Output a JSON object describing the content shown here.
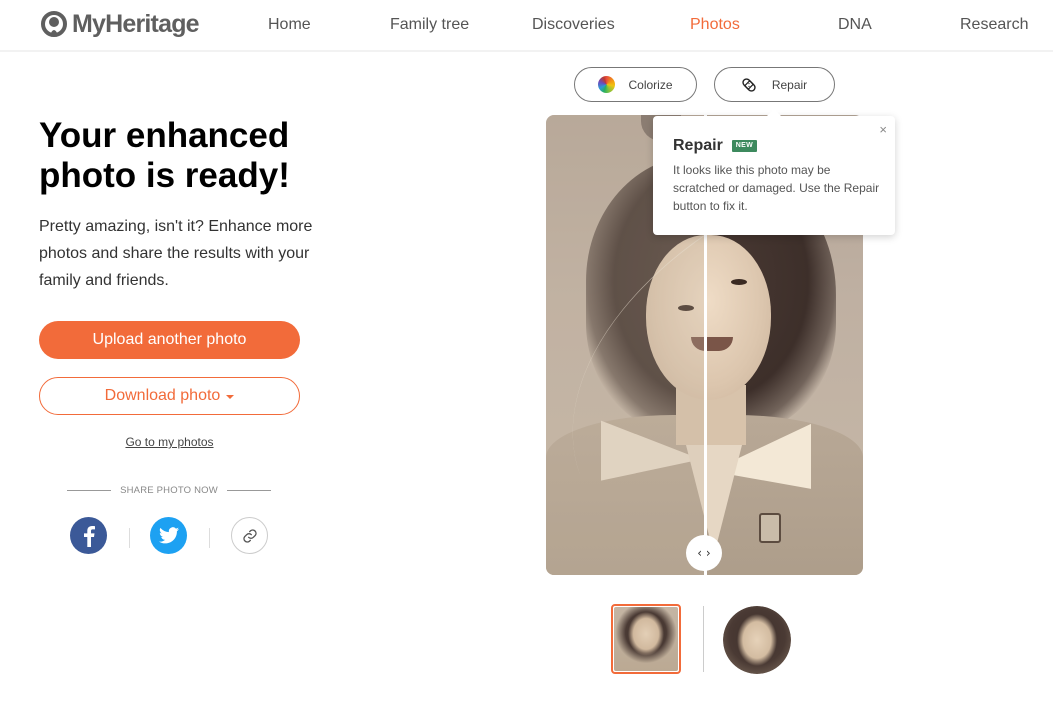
{
  "header": {
    "logo_text": "MyHeritage",
    "nav": [
      {
        "label": "Home",
        "active": false
      },
      {
        "label": "Family tree",
        "active": false
      },
      {
        "label": "Discoveries",
        "active": false
      },
      {
        "label": "Photos",
        "active": true
      },
      {
        "label": "DNA",
        "active": false
      },
      {
        "label": "Research",
        "active": false
      }
    ]
  },
  "main": {
    "title": "Your enhanced photo is ready!",
    "subtitle": "Pretty amazing, isn't it? Enhance more photos and share the results with your family and friends.",
    "upload_button": "Upload another photo",
    "download_button": "Download photo",
    "my_photos_link": "Go to my photos",
    "share_label": "SHARE PHOTO NOW",
    "share_icons": [
      "facebook-icon",
      "twitter-icon",
      "link-icon"
    ]
  },
  "tools": {
    "colorize_label": "Colorize",
    "repair_label": "Repair"
  },
  "tooltip": {
    "title": "Repair",
    "badge": "NEW",
    "body": "It looks like this photo may be scratched or damaged. Use the Repair button to fix it.",
    "close": "×"
  },
  "viewer": {
    "handle_label": "‹ ›",
    "thumbnails": [
      "enhanced-photo",
      "face-crop"
    ]
  },
  "colors": {
    "accent": "#f26b3a",
    "badge_green": "#3d8a5e",
    "facebook": "#3b5998",
    "twitter": "#1da1f2"
  }
}
